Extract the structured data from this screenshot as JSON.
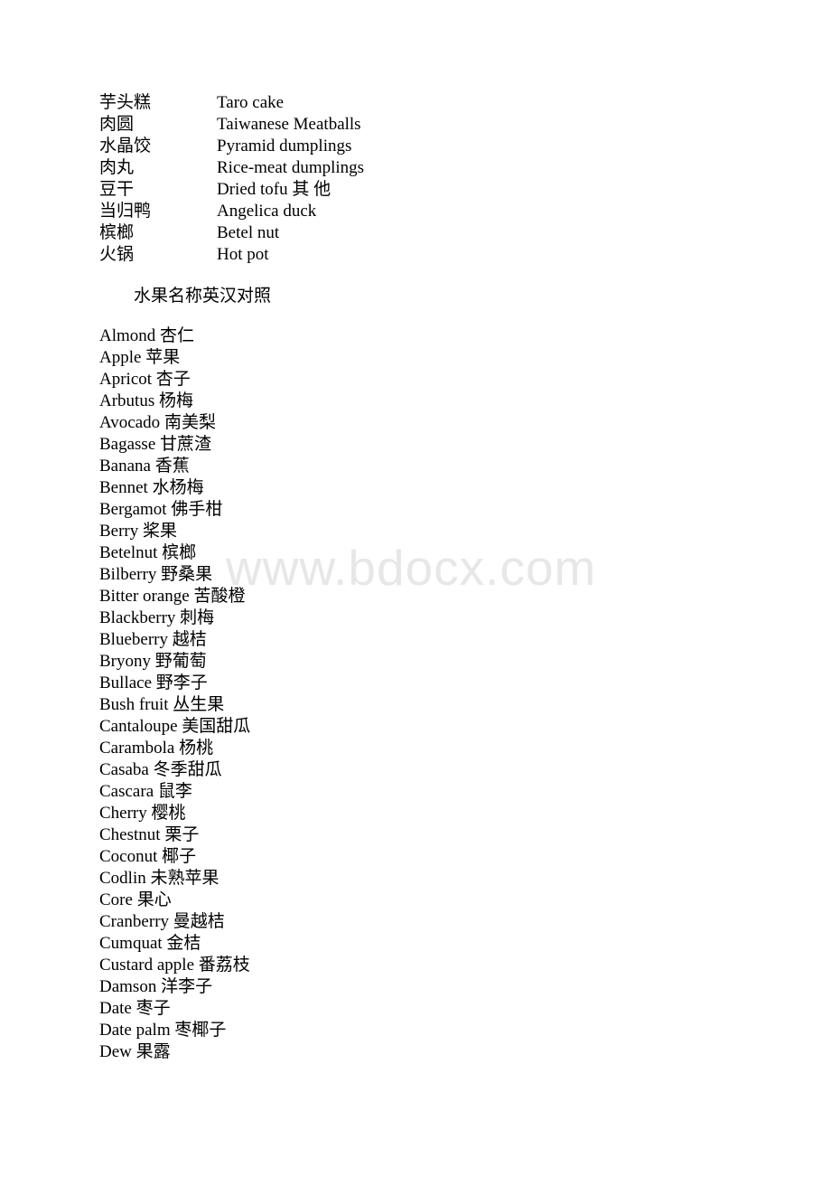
{
  "watermark": {
    "text": "www.bdocx.com",
    "color": "#e7e7e7"
  },
  "food_table": {
    "rows": [
      {
        "cn": "芋头糕",
        "en": "Taro cake"
      },
      {
        "cn": "肉圆",
        "en": "Taiwanese Meatballs"
      },
      {
        "cn": "水晶饺",
        "en": "Pyramid dumplings"
      },
      {
        "cn": "肉丸",
        "en": "Rice-meat dumplings"
      },
      {
        "cn": "豆干",
        "en": "Dried tofu 其 他"
      },
      {
        "cn": "当归鸭",
        "en": "Angelica duck"
      },
      {
        "cn": "槟榔",
        "en": "Betel nut"
      },
      {
        "cn": "火锅",
        "en": "Hot pot"
      }
    ]
  },
  "section": {
    "heading": "水果名称英汉对照"
  },
  "fruit_list": {
    "items": [
      {
        "term": "Almond",
        "gloss": "杏仁"
      },
      {
        "term": "Apple",
        "gloss": "苹果"
      },
      {
        "term": "Apricot",
        "gloss": "杏子"
      },
      {
        "term": "Arbutus",
        "gloss": "杨梅"
      },
      {
        "term": "Avocado",
        "gloss": "南美梨"
      },
      {
        "term": "Bagasse",
        "gloss": "甘蔗渣"
      },
      {
        "term": "Banana",
        "gloss": "香蕉"
      },
      {
        "term": "Bennet",
        "gloss": "水杨梅"
      },
      {
        "term": "Bergamot",
        "gloss": "佛手柑"
      },
      {
        "term": "Berry",
        "gloss": "桨果"
      },
      {
        "term": "Betelnut",
        "gloss": "槟榔"
      },
      {
        "term": "Bilberry",
        "gloss": "野桑果"
      },
      {
        "term": "Bitter orange",
        "gloss": "苦酸橙"
      },
      {
        "term": "Blackberry",
        "gloss": "刺梅"
      },
      {
        "term": "Blueberry",
        "gloss": "越桔"
      },
      {
        "term": "Bryony",
        "gloss": "野葡萄"
      },
      {
        "term": "Bullace",
        "gloss": "野李子"
      },
      {
        "term": "Bush fruit",
        "gloss": "丛生果"
      },
      {
        "term": "Cantaloupe",
        "gloss": "美国甜瓜"
      },
      {
        "term": "Carambola",
        "gloss": "杨桃"
      },
      {
        "term": "Casaba",
        "gloss": "冬季甜瓜"
      },
      {
        "term": "Cascara",
        "gloss": "鼠李"
      },
      {
        "term": "Cherry",
        "gloss": "樱桃"
      },
      {
        "term": "Chestnut",
        "gloss": "栗子"
      },
      {
        "term": "Coconut",
        "gloss": "椰子"
      },
      {
        "term": "Codlin",
        "gloss": "未熟苹果"
      },
      {
        "term": "Core",
        "gloss": "果心"
      },
      {
        "term": "Cranberry",
        "gloss": "曼越桔"
      },
      {
        "term": "Cumquat",
        "gloss": "金桔"
      },
      {
        "term": "Custard apple",
        "gloss": "番荔枝"
      },
      {
        "term": "Damson",
        "gloss": "洋李子"
      },
      {
        "term": "Date",
        "gloss": "枣子"
      },
      {
        "term": "Date palm",
        "gloss": "枣椰子"
      },
      {
        "term": "Dew",
        "gloss": "果露"
      }
    ]
  }
}
